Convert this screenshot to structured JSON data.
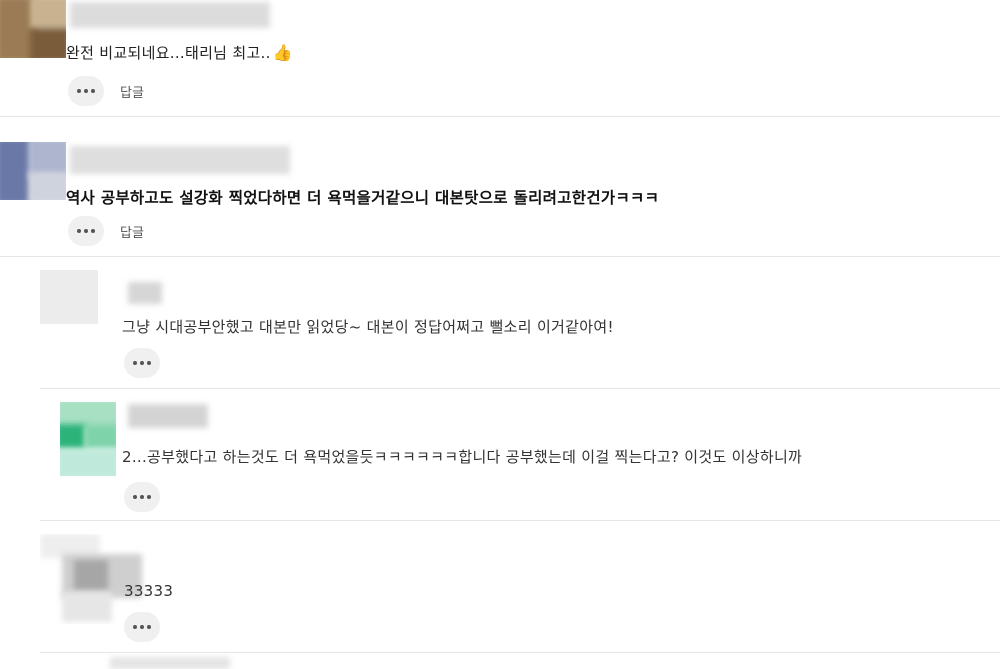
{
  "comments": [
    {
      "text": "완전 비교되네요...태리님 최고..",
      "has_thumb": true,
      "reply_label": "답글"
    },
    {
      "text": "역사 공부하고도 설강화 찍었다하면 더 욕먹을거같으니 대본탓으로 돌리려고한건가ㅋㅋㅋ",
      "reply_label": "답글"
    },
    {
      "text": "그냥 시대공부안했고 대본만 읽었당~ 대본이 정답어쩌고 뻘소리 이거같아여!"
    },
    {
      "text": "2...공부했다고 하는것도 더 욕먹었을듯ㅋㅋㅋㅋㅋㅋ합니다 공부했는데 이걸 찍는다고? 이것도 이상하니까"
    },
    {
      "text": "33333"
    }
  ],
  "icons": {
    "thumb": "thumbs-up-icon",
    "more": "more-dots-icon"
  },
  "colors": {
    "divider": "#e6e6e6",
    "button_bg": "#f0f0f0"
  }
}
